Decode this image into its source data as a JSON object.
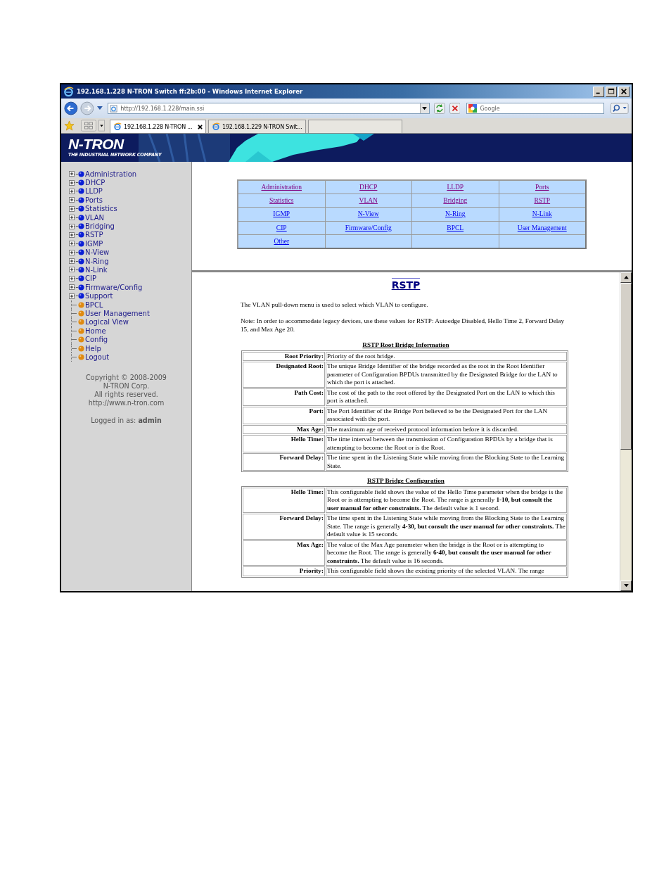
{
  "window": {
    "title": "192.168.1.228 N-TRON Switch ff:2b:00 - Windows Internet Explorer"
  },
  "address_bar": {
    "value": "http://192.168.1.228/main.ssi"
  },
  "search": {
    "placeholder": "Google"
  },
  "tabs": [
    {
      "label": "192.168.1.228 N-TRON ...",
      "selected": true
    },
    {
      "label": "192.168.1.229 N-TRON Swit...",
      "selected": false
    }
  ],
  "banner": {
    "logo": "N-TRON",
    "tagline": "THE INDUSTRIAL NETWORK COMPANY"
  },
  "sidebar": {
    "items": [
      {
        "label": "Administration",
        "kind": "folder",
        "expanded": false
      },
      {
        "label": "DHCP",
        "kind": "folder",
        "expanded": false
      },
      {
        "label": "LLDP",
        "kind": "folder",
        "expanded": false
      },
      {
        "label": "Ports",
        "kind": "folder",
        "expanded": false
      },
      {
        "label": "Statistics",
        "kind": "folder",
        "expanded": false
      },
      {
        "label": "VLAN",
        "kind": "folder",
        "expanded": false
      },
      {
        "label": "Bridging",
        "kind": "folder",
        "expanded": false
      },
      {
        "label": "RSTP",
        "kind": "folder",
        "expanded": false
      },
      {
        "label": "IGMP",
        "kind": "folder",
        "expanded": false
      },
      {
        "label": "N-View",
        "kind": "folder",
        "expanded": false
      },
      {
        "label": "N-Ring",
        "kind": "folder",
        "expanded": false
      },
      {
        "label": "N-Link",
        "kind": "folder",
        "expanded": false
      },
      {
        "label": "CIP",
        "kind": "folder",
        "expanded": false
      },
      {
        "label": "Firmware/Config",
        "kind": "folder",
        "expanded": false
      },
      {
        "label": "Support",
        "kind": "folder",
        "expanded": false
      },
      {
        "label": "BPCL",
        "kind": "page"
      },
      {
        "label": "User Management",
        "kind": "page"
      },
      {
        "label": "Logical View",
        "kind": "page"
      },
      {
        "label": "Home",
        "kind": "page"
      },
      {
        "label": "Config",
        "kind": "page"
      },
      {
        "label": "Help",
        "kind": "page"
      },
      {
        "label": "Logout",
        "kind": "page"
      }
    ],
    "copyright": [
      "Copyright © 2008-2009",
      "N-TRON Corp.",
      "All rights reserved.",
      "http://www.n-tron.com"
    ],
    "login": "Logged in as: **admin**"
  },
  "links": [
    {
      "label": "Administration",
      "visited": true
    },
    {
      "label": "DHCP",
      "visited": true
    },
    {
      "label": "LLDP",
      "visited": true
    },
    {
      "label": "Ports",
      "visited": true
    },
    {
      "label": "Statistics",
      "visited": true
    },
    {
      "label": "VLAN",
      "visited": true
    },
    {
      "label": "Bridging",
      "visited": true
    },
    {
      "label": "RSTP",
      "visited": true
    },
    {
      "label": "IGMP",
      "visited": false
    },
    {
      "label": "N-View",
      "visited": false
    },
    {
      "label": "N-Ring",
      "visited": false
    },
    {
      "label": "N-Link",
      "visited": false
    },
    {
      "label": "CIP",
      "visited": false
    },
    {
      "label": "Firmware/Config",
      "visited": false
    },
    {
      "label": "BPCL",
      "visited": false
    },
    {
      "label": "User Management",
      "visited": false
    },
    {
      "label": "Other",
      "visited": false
    }
  ],
  "content": {
    "title": "RSTP",
    "intro": "The VLAN pull-down menu is used to select which VLAN to configure.",
    "note": "Note: In order to accommodate legacy devices, use these values for RSTP: Autoedge Disabled, Hello Time 2, Forward Delay 15, and Max Age 20.",
    "sections": [
      {
        "title": "RSTP Root Bridge Information",
        "rows": [
          {
            "label": "Root Priority:",
            "text": "Priority of the root bridge."
          },
          {
            "label": "Designated Root:",
            "text": "The unique Bridge Identifier of the bridge recorded as the root in the Root Identifier parameter of Configuration BPDUs transmitted by the Designated Bridge for the LAN to which the port is attached."
          },
          {
            "label": "Path Cost:",
            "text": "The cost of the path to the root offered by the Designated Port on the LAN to which this port is attached."
          },
          {
            "label": "Port:",
            "text": "The Port Identifier of the Bridge Port believed to be the Designated Port for the LAN associated with the port."
          },
          {
            "label": "Max Age:",
            "text": "The maximum age of received protocol information before it is discarded."
          },
          {
            "label": "Hello Time:",
            "text": "The time interval between the transmission of Configuration BPDUs by a bridge that is attempting to become the Root or is the Root."
          },
          {
            "label": "Forward Delay:",
            "text": "The time spent in the Listening State while moving from the Blocking State to the Learning State."
          }
        ]
      },
      {
        "title": "RSTP Bridge Configuration",
        "rows": [
          {
            "label": "Hello Time:",
            "text": "This configurable field shows the value of the Hello Time parameter when the bridge is the Root or is attempting to become the Root. The range is generally **1-10, but consult the user manual for other constraints.** The default value is 1 second."
          },
          {
            "label": "Forward Delay:",
            "text": "The time spent in the Listening State while moving from the Blocking State to the Learning State. The range is generally **4-30, but consult the user manual for other constraints.** The default value is 15 seconds."
          },
          {
            "label": "Max Age:",
            "text": "The value of the Max Age parameter when the bridge is the Root or is attempting to become the Root. The range is generally **6-40, but consult the user manual for other constraints.** The default value is 16 seconds."
          },
          {
            "label": "Priority:",
            "text": "This configurable field shows the existing priority of the selected VLAN. The range"
          }
        ]
      }
    ]
  }
}
